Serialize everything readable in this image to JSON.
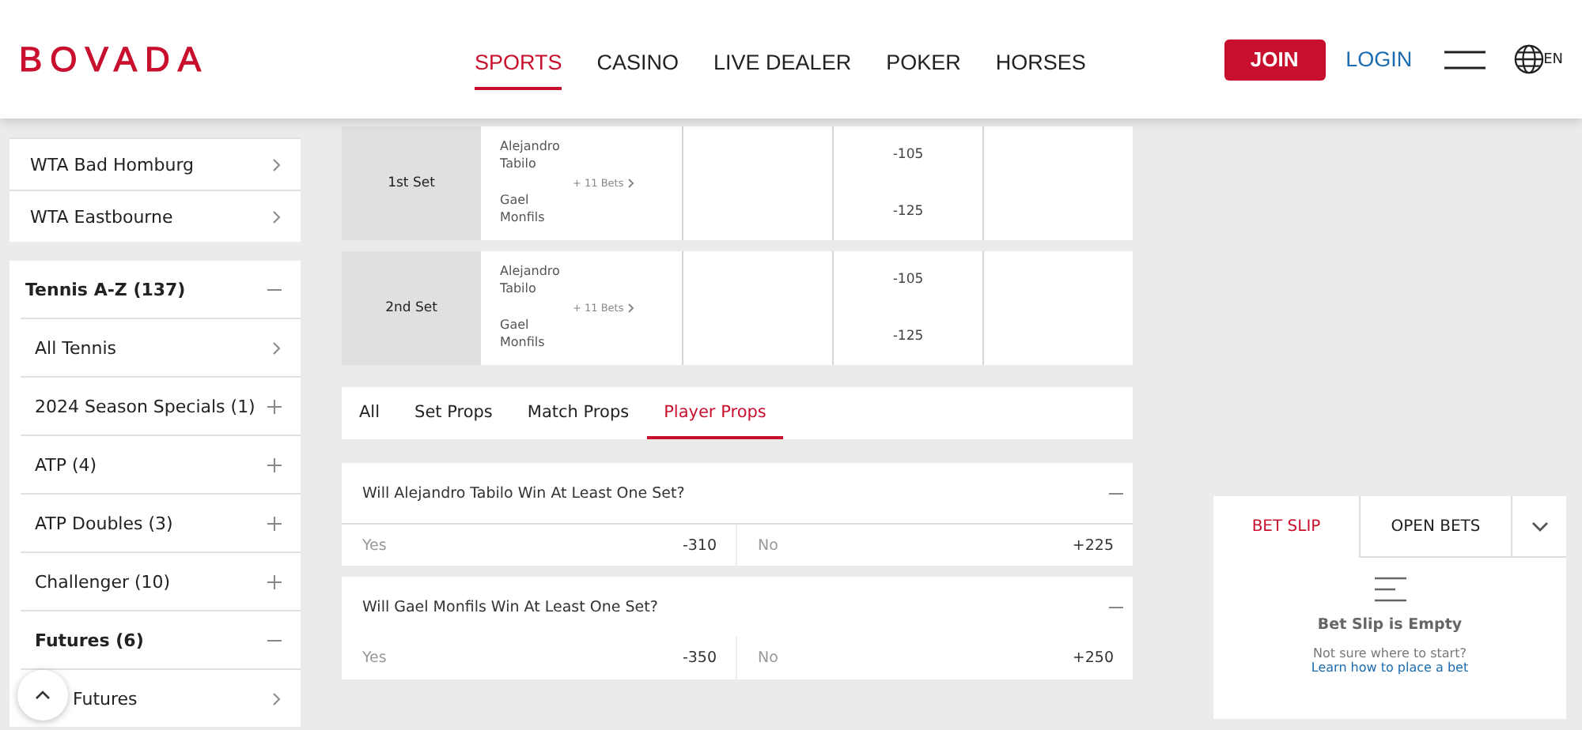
{
  "header": {
    "logo": "BOVADA",
    "nav": [
      {
        "label": "SPORTS",
        "selected": true
      },
      {
        "label": "CASINO",
        "selected": false
      },
      {
        "label": "LIVE DEALER",
        "selected": false
      },
      {
        "label": "POKER",
        "selected": false
      },
      {
        "label": "HORSES",
        "selected": false
      }
    ],
    "join": "JOIN",
    "login": "LOGIN",
    "language": "EN"
  },
  "sidebar": {
    "top_items": [
      "WTA Bad Homburg",
      "WTA Eastbourne"
    ],
    "section": {
      "title": "Tennis A-Z (137)",
      "expanded": true,
      "items": [
        {
          "label": "All Tennis",
          "kind": "link"
        },
        {
          "label": "2024 Season Specials (1)",
          "kind": "group",
          "expanded": false
        },
        {
          "label": "ATP (4)",
          "kind": "group",
          "expanded": false
        },
        {
          "label": "ATP Doubles (3)",
          "kind": "group",
          "expanded": false
        },
        {
          "label": "Challenger (10)",
          "kind": "group",
          "expanded": false
        },
        {
          "label": "Futures (6)",
          "kind": "group",
          "expanded": true
        },
        {
          "label": "Futures",
          "kind": "link"
        }
      ]
    }
  },
  "markets": [
    {
      "label": "1st Set",
      "players": [
        "Alejandro Tabilo",
        "Gael Monfils"
      ],
      "more": "+ 11 Bets",
      "odds": [
        "-105",
        "-125"
      ]
    },
    {
      "label": "2nd Set",
      "players": [
        "Alejandro Tabilo",
        "Gael Monfils"
      ],
      "more": "+ 11 Bets",
      "odds": [
        "-105",
        "-125"
      ]
    }
  ],
  "prop_tabs": [
    {
      "label": "All",
      "selected": false
    },
    {
      "label": "Set Props",
      "selected": false
    },
    {
      "label": "Match Props",
      "selected": false
    },
    {
      "label": "Player Props",
      "selected": true
    }
  ],
  "props": [
    {
      "question": "Will Alejandro Tabilo Win At Least One Set?",
      "expanded": true,
      "outcomes": [
        {
          "label": "Yes",
          "odds": "-310"
        },
        {
          "label": "No",
          "odds": "+225"
        }
      ]
    },
    {
      "question": "Will Gael Monfils Win At Least One Set?",
      "expanded": true,
      "outcomes": [
        {
          "label": "Yes",
          "odds": "-350"
        },
        {
          "label": "No",
          "odds": "+250"
        }
      ]
    }
  ],
  "bet_slip": {
    "tabs": [
      {
        "label": "BET SLIP",
        "selected": true
      },
      {
        "label": "OPEN BETS",
        "selected": false
      }
    ],
    "title": "Bet Slip is Empty",
    "hint": "Not sure where to start?",
    "link": "Learn how to place a bet"
  }
}
